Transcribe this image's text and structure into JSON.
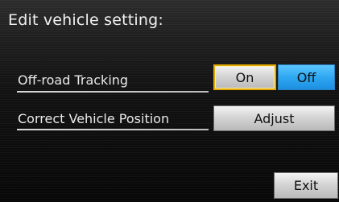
{
  "screen": {
    "title": "Edit vehicle setting:"
  },
  "settings": [
    {
      "label": "Off-road Tracking"
    },
    {
      "label": "Correct Vehicle Position"
    }
  ],
  "buttons": {
    "on": "On",
    "off": "Off",
    "adjust": "Adjust",
    "exit": "Exit"
  },
  "state": {
    "offroad_tracking_selected": "Off",
    "offroad_tracking_focused": "On"
  },
  "colors": {
    "selected_blue": "#2ea8f2",
    "focus_outline": "#e0a800"
  }
}
